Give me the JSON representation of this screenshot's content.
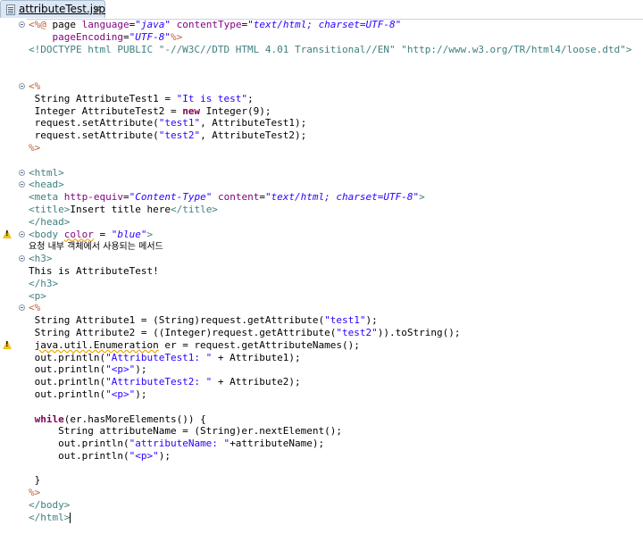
{
  "editor": {
    "tab": {
      "file_name": "attributeTest.jsp",
      "close_glyph": "✕"
    },
    "current_line": 43
  },
  "code_lines": [
    {
      "fold": true,
      "warn": false,
      "tokens": [
        [
          "delim",
          "<%@ "
        ],
        [
          "text",
          "page "
        ],
        [
          "attr",
          "language"
        ],
        [
          "text",
          "="
        ],
        [
          "val",
          "\"java\""
        ],
        [
          "text",
          " "
        ],
        [
          "attr",
          "contentType"
        ],
        [
          "text",
          "="
        ],
        [
          "val",
          "\"text/html; charset=UTF-8\""
        ]
      ]
    },
    {
      "fold": false,
      "warn": false,
      "tokens": [
        [
          "text",
          "    "
        ],
        [
          "attr",
          "pageEncoding"
        ],
        [
          "text",
          "="
        ],
        [
          "val",
          "\"UTF-8\""
        ],
        [
          "delim",
          "%>"
        ]
      ]
    },
    {
      "fold": false,
      "warn": false,
      "tokens": [
        [
          "doctype",
          "<!DOCTYPE html PUBLIC \"-//W3C//DTD HTML 4.01 Transitional//EN\" \"http://www.w3.org/TR/html4/loose.dtd\">"
        ]
      ]
    },
    {
      "fold": false,
      "warn": false,
      "tokens": []
    },
    {
      "fold": false,
      "warn": false,
      "tokens": []
    },
    {
      "fold": true,
      "warn": false,
      "tokens": [
        [
          "delim",
          "<%"
        ]
      ]
    },
    {
      "fold": false,
      "warn": false,
      "tokens": [
        [
          "text",
          " String AttributeTest1 = "
        ],
        [
          "str",
          "\"It is test\""
        ],
        [
          "text",
          ";"
        ]
      ]
    },
    {
      "fold": false,
      "warn": false,
      "tokens": [
        [
          "text",
          " Integer AttributeTest2 = "
        ],
        [
          "kw",
          "new"
        ],
        [
          "text",
          " Integer(9);"
        ]
      ]
    },
    {
      "fold": false,
      "warn": false,
      "tokens": [
        [
          "text",
          " request.setAttribute("
        ],
        [
          "str",
          "\"test1\""
        ],
        [
          "text",
          ", AttributeTest1);"
        ]
      ]
    },
    {
      "fold": false,
      "warn": false,
      "tokens": [
        [
          "text",
          " request.setAttribute("
        ],
        [
          "str",
          "\"test2\""
        ],
        [
          "text",
          ", AttributeTest2);"
        ]
      ]
    },
    {
      "fold": false,
      "warn": false,
      "tokens": [
        [
          "delim",
          "%>"
        ]
      ]
    },
    {
      "fold": false,
      "warn": false,
      "tokens": []
    },
    {
      "fold": true,
      "warn": false,
      "tokens": [
        [
          "tag",
          "<html>"
        ]
      ]
    },
    {
      "fold": true,
      "warn": false,
      "tokens": [
        [
          "tag",
          "<head>"
        ]
      ]
    },
    {
      "fold": false,
      "warn": false,
      "tokens": [
        [
          "tag",
          "<meta "
        ],
        [
          "attr",
          "http-equiv"
        ],
        [
          "text",
          "="
        ],
        [
          "val",
          "\"Content-Type\""
        ],
        [
          "text",
          " "
        ],
        [
          "attr",
          "content"
        ],
        [
          "text",
          "="
        ],
        [
          "val",
          "\"text/html; charset=UTF-8\""
        ],
        [
          "tag",
          ">"
        ]
      ]
    },
    {
      "fold": false,
      "warn": false,
      "tokens": [
        [
          "tag",
          "<title>"
        ],
        [
          "text",
          "Insert title here"
        ],
        [
          "tag",
          "</title>"
        ]
      ]
    },
    {
      "fold": false,
      "warn": false,
      "tokens": [
        [
          "tag",
          "</head>"
        ]
      ]
    },
    {
      "fold": true,
      "warn": true,
      "tokens": [
        [
          "tag",
          "<body "
        ],
        [
          "attrsq",
          "color"
        ],
        [
          "text",
          " = "
        ],
        [
          "val",
          "\"blue\""
        ],
        [
          "tag",
          ">"
        ]
      ]
    },
    {
      "fold": false,
      "warn": false,
      "tokens": [
        [
          "kr",
          "요청 내부 객체에서 사용되는 메서드"
        ]
      ]
    },
    {
      "fold": true,
      "warn": false,
      "tokens": [
        [
          "tag",
          "<h3>"
        ]
      ]
    },
    {
      "fold": false,
      "warn": false,
      "tokens": [
        [
          "text",
          "This is AttributeTest!"
        ]
      ]
    },
    {
      "fold": false,
      "warn": false,
      "tokens": [
        [
          "tag",
          "</h3>"
        ]
      ]
    },
    {
      "fold": false,
      "warn": false,
      "tokens": [
        [
          "tag",
          "<p>"
        ]
      ]
    },
    {
      "fold": true,
      "warn": false,
      "tokens": [
        [
          "delim",
          "<%"
        ]
      ]
    },
    {
      "fold": false,
      "warn": false,
      "tokens": [
        [
          "text",
          " String Attribute1 = (String)request.getAttribute("
        ],
        [
          "str",
          "\"test1\""
        ],
        [
          "text",
          ");"
        ]
      ]
    },
    {
      "fold": false,
      "warn": false,
      "tokens": [
        [
          "text",
          " String Attribute2 = ((Integer)request.getAttribute("
        ],
        [
          "str",
          "\"test2\""
        ],
        [
          "text",
          ")).toString();"
        ]
      ]
    },
    {
      "fold": false,
      "warn": true,
      "tokens": [
        [
          "text",
          " "
        ],
        [
          "textsq",
          "java.util.Enumeration"
        ],
        [
          "text",
          " er = request.getAttributeNames();"
        ]
      ]
    },
    {
      "fold": false,
      "warn": false,
      "tokens": [
        [
          "text",
          " out.println("
        ],
        [
          "str",
          "\"AttributeTest1: \""
        ],
        [
          "text",
          " + Attribute1);"
        ]
      ]
    },
    {
      "fold": false,
      "warn": false,
      "tokens": [
        [
          "text",
          " out.println("
        ],
        [
          "str",
          "\"<p>\""
        ],
        [
          "text",
          ");"
        ]
      ]
    },
    {
      "fold": false,
      "warn": false,
      "tokens": [
        [
          "text",
          " out.println("
        ],
        [
          "str",
          "\"AttributeTest2: \""
        ],
        [
          "text",
          " + Attribute2);"
        ]
      ]
    },
    {
      "fold": false,
      "warn": false,
      "tokens": [
        [
          "text",
          " out.println("
        ],
        [
          "str",
          "\"<p>\""
        ],
        [
          "text",
          ");"
        ]
      ]
    },
    {
      "fold": false,
      "warn": false,
      "tokens": []
    },
    {
      "fold": false,
      "warn": false,
      "tokens": [
        [
          "text",
          " "
        ],
        [
          "kw",
          "while"
        ],
        [
          "text",
          "(er.hasMoreElements()) {"
        ]
      ]
    },
    {
      "fold": false,
      "warn": false,
      "tokens": [
        [
          "text",
          "     String attributeName = (String)er.nextElement();"
        ]
      ]
    },
    {
      "fold": false,
      "warn": false,
      "tokens": [
        [
          "text",
          "     out.println("
        ],
        [
          "str",
          "\"attributeName: \""
        ],
        [
          "text",
          "+attributeName);"
        ]
      ]
    },
    {
      "fold": false,
      "warn": false,
      "tokens": [
        [
          "text",
          "     out.println("
        ],
        [
          "str",
          "\"<p>\""
        ],
        [
          "text",
          ");"
        ]
      ]
    },
    {
      "fold": false,
      "warn": false,
      "tokens": []
    },
    {
      "fold": false,
      "warn": false,
      "tokens": [
        [
          "text",
          " }"
        ]
      ]
    },
    {
      "fold": false,
      "warn": false,
      "tokens": [
        [
          "delim",
          "%>"
        ]
      ]
    },
    {
      "fold": false,
      "warn": false,
      "tokens": [
        [
          "tag",
          "</body>"
        ]
      ]
    },
    {
      "fold": false,
      "warn": false,
      "tokens": [
        [
          "tag",
          "</html>"
        ],
        [
          "caret",
          ""
        ]
      ]
    }
  ]
}
